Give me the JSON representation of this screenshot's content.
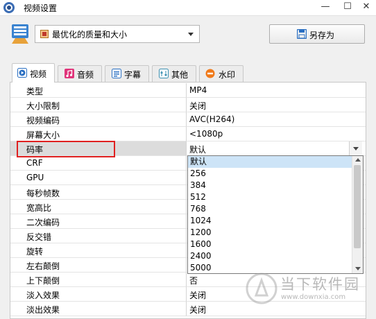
{
  "window": {
    "title": "视频设置",
    "minimize": "—",
    "restore": "☐",
    "close": "✕"
  },
  "toolbar": {
    "preset_value": "最优化的质量和大小",
    "save_as_label": "另存为"
  },
  "tabs": [
    {
      "label": "视频",
      "icon": "play-icon"
    },
    {
      "label": "音频",
      "icon": "music-icon"
    },
    {
      "label": "字幕",
      "icon": "subtitle-icon"
    },
    {
      "label": "其他",
      "icon": "sliders-icon"
    },
    {
      "label": "水印",
      "icon": "new-badge-icon"
    }
  ],
  "settings": [
    {
      "label": "类型",
      "value": "MP4"
    },
    {
      "label": "大小限制",
      "value": "关闭"
    },
    {
      "label": "视频编码",
      "value": "AVC(H264)"
    },
    {
      "label": "屏幕大小",
      "value": "<1080p"
    },
    {
      "label": "码率",
      "value": "默认"
    },
    {
      "label": "CRF",
      "value": ""
    },
    {
      "label": "GPU",
      "value": ""
    },
    {
      "label": "每秒帧数",
      "value": ""
    },
    {
      "label": "宽高比",
      "value": ""
    },
    {
      "label": "二次编码",
      "value": ""
    },
    {
      "label": "反交错",
      "value": ""
    },
    {
      "label": "旋转",
      "value": ""
    },
    {
      "label": "左右颠倒",
      "value": ""
    },
    {
      "label": "上下颠倒",
      "value": "否"
    },
    {
      "label": "淡入效果",
      "value": "关闭"
    },
    {
      "label": "淡出效果",
      "value": "关闭"
    }
  ],
  "bitrate_dropdown": {
    "options": [
      "默认",
      "256",
      "384",
      "512",
      "768",
      "1024",
      "1200",
      "1600",
      "2400",
      "5000"
    ],
    "highlighted": "默认"
  },
  "watermark": {
    "text": "当下软件园",
    "url": "www.downxia.com"
  },
  "colors": {
    "highlight_box": "#e02020",
    "option_highlight": "#cde4f7",
    "save_icon": "#2a6fc2",
    "preset_icon": "#3a83d0",
    "music_tab_icon": "#e0347a",
    "new_badge": "#f07a1a"
  }
}
